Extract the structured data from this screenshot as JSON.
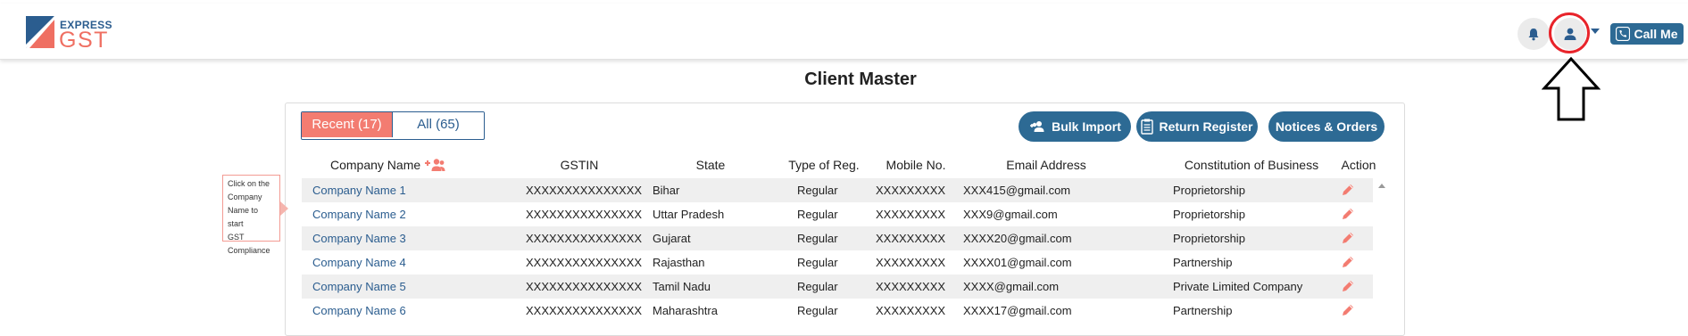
{
  "brand": {
    "line1": "EXPRESS",
    "line2": "GST"
  },
  "header": {
    "call_me": "Call Me"
  },
  "page": {
    "title": "Client Master"
  },
  "tabs": [
    {
      "label": "Recent (17)"
    },
    {
      "label": "All (65)"
    }
  ],
  "actions": {
    "bulk_import": "Bulk Import",
    "return_register": "Return Register",
    "notices_orders": "Notices & Orders"
  },
  "columns": {
    "company_name": "Company Name",
    "gstin": "GSTIN",
    "state": "State",
    "type": "Type of Reg.",
    "mobile": "Mobile No.",
    "email": "Email Address",
    "constitution": "Constitution of Business",
    "action": "Action"
  },
  "tooltip": {
    "line1": "Click on the",
    "line2": "Company",
    "line3": "Name to start",
    "line4": "GST",
    "line5": "Compliance"
  },
  "rows": [
    {
      "name": "Company Name 1",
      "gstin": "XXXXXXXXXXXXXXX",
      "state": "Bihar",
      "type": "Regular",
      "mobile": "XXXXXXXXX",
      "email": "XXX415@gmail.com",
      "constitution": "Proprietorship"
    },
    {
      "name": "Company Name 2",
      "gstin": "XXXXXXXXXXXXXXX",
      "state": "Uttar Pradesh",
      "type": "Regular",
      "mobile": "XXXXXXXXX",
      "email": "XXX9@gmail.com",
      "constitution": "Proprietorship"
    },
    {
      "name": "Company Name 3",
      "gstin": "XXXXXXXXXXXXXXX",
      "state": "Gujarat",
      "type": "Regular",
      "mobile": "XXXXXXXXX",
      "email": "XXXX20@gmail.com",
      "constitution": "Proprietorship"
    },
    {
      "name": "Company Name 4",
      "gstin": "XXXXXXXXXXXXXXX",
      "state": "Rajasthan",
      "type": "Regular",
      "mobile": "XXXXXXXXX",
      "email": "XXXX01@gmail.com",
      "constitution": "Partnership"
    },
    {
      "name": "Company Name 5",
      "gstin": "XXXXXXXXXXXXXXX",
      "state": "Tamil Nadu",
      "type": "Regular",
      "mobile": "XXXXXXXXX",
      "email": "XXXX@gmail.com",
      "constitution": "Private Limited Company"
    },
    {
      "name": "Company Name 6",
      "gstin": "XXXXXXXXXXXXXXX",
      "state": "Maharashtra",
      "type": "Regular",
      "mobile": "XXXXXXXXX",
      "email": "XXXX17@gmail.com",
      "constitution": "Partnership"
    }
  ],
  "icons": {
    "bell": "bell-icon",
    "user": "user-icon",
    "phone": "phone-icon",
    "add_users": "add-users-icon",
    "document": "document-icon",
    "edit": "pencil-icon",
    "arrow": "up-arrow-callout"
  },
  "colors": {
    "primary": "#2d6a94",
    "accent": "#f37c71",
    "highlight": "#e8232a",
    "link": "#2b5d8f"
  }
}
